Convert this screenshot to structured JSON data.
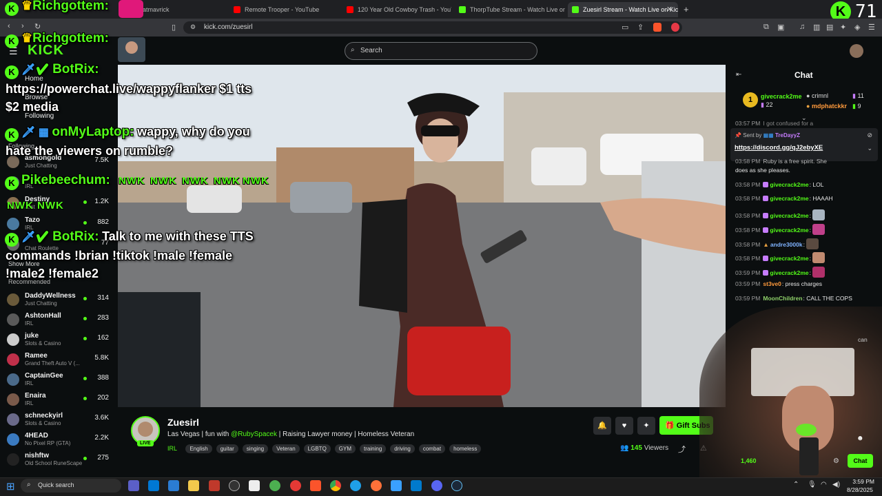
{
  "browser": {
    "tabs": [
      {
        "label": "atmavrick"
      },
      {
        "label": "Remote Trooper - YouTube"
      },
      {
        "label": "120 Year Old Cowboy Trash - YouTube"
      },
      {
        "label": "ThorpTube Stream - Watch Live on Kick"
      },
      {
        "label": "Zuesirl Stream - Watch Live on Kick"
      }
    ],
    "url": "kick.com/zuesirl",
    "counter": "71"
  },
  "site": {
    "search_placeholder": "Search",
    "nav": {
      "home": "Home",
      "browse": "Browse",
      "following": "Following"
    },
    "following_header": "Following",
    "show_more": "Show More",
    "recommended_header": "Recommended",
    "following_channels": [
      {
        "name": "asmongold",
        "category": "Just Chatting",
        "viewers": "7.5K"
      },
      {
        "name": "",
        "category": "IRL",
        "viewers": ""
      },
      {
        "name": "Destiny",
        "category": "Just",
        "viewers": "1.2K"
      },
      {
        "name": "Tazo",
        "category": "IRL",
        "viewers": "882"
      },
      {
        "name": "",
        "category": "Chat Roulette",
        "viewers": "77"
      }
    ],
    "recommended_channels": [
      {
        "name": "DaddyWellness",
        "category": "Just Chatting",
        "viewers": "314"
      },
      {
        "name": "AshtonHall",
        "category": "IRL",
        "viewers": "283"
      },
      {
        "name": "juke",
        "category": "Slots & Casino",
        "viewers": "162"
      },
      {
        "name": "Ramee",
        "category": "Grand Theft Auto V (...",
        "viewers": "5.8K"
      },
      {
        "name": "CaptainGee",
        "category": "IRL",
        "viewers": "388"
      },
      {
        "name": "Enaira",
        "category": "IRL",
        "viewers": "202"
      },
      {
        "name": "schneckyirl",
        "category": "Slots & Casino",
        "viewers": "3.6K"
      },
      {
        "name": "4HEAD",
        "category": "No Pixel RP (GTA)",
        "viewers": "2.2K"
      },
      {
        "name": "nishftw",
        "category": "Old School RuneScape",
        "viewers": "275"
      }
    ]
  },
  "overlay": {
    "top_user": "Richgottem:",
    "kick_word": "KICK",
    "alerts": [
      {
        "user": "BotRix:",
        "text": "https://powerchat.live/wappyflanker $1 tts",
        "text2": "$2 media"
      },
      {
        "user": "onMyLaptop:",
        "text": "wappy, why do you",
        "text2": "hate the viewers on rumble?"
      },
      {
        "user": "Pikebeechum:",
        "text": "",
        "text2": ""
      },
      {
        "user": "BotRix:",
        "text": "Talk to me with these TTS",
        "text2": "commands !brian !tiktok !male !female",
        "text3": "!male2 !female2"
      }
    ],
    "emote_word": "NWK"
  },
  "stream": {
    "live_badge": "LIVE",
    "channel": "Zuesirl",
    "title_pre": "Las Vegas | fun with ",
    "title_mention": "@RubySpacek",
    "title_post": " | Raising Lawyer money | Homeless Veteran",
    "category": "IRL",
    "tags": [
      "English",
      "guitar",
      "singing",
      "Veteran",
      "LGBTQ",
      "GYM",
      "training",
      "driving",
      "combat",
      "homeless"
    ],
    "viewers": "145",
    "viewers_label": "Viewers",
    "gift_label": "Gift Subs"
  },
  "chat": {
    "title": "Chat",
    "leaderboard": [
      {
        "rank": "1",
        "user": "givecrack2me",
        "count": "22"
      },
      {
        "rank": "",
        "user": "crimnl",
        "count": "11"
      },
      {
        "rank": "",
        "user": "mdphatckkr",
        "count": "9"
      }
    ],
    "pinned_prefix": "Sent by",
    "pinned_user": "TreDayyZ",
    "pinned_link": "https://discord.gg/qJ2ebyXE",
    "partial_top": "I got confused for a",
    "partial_2": "Ruby is a free spirit. She",
    "partial_3": "does as she pleases.",
    "messages": [
      {
        "time": "03:58 PM",
        "user": "givecrack2me",
        "text": ": LOL",
        "color": "#53fc18"
      },
      {
        "time": "03:58 PM",
        "user": "givecrack2me",
        "text": ": HAAAH",
        "color": "#53fc18"
      },
      {
        "time": "03:58 PM",
        "user": "givecrack2me",
        "text": ":",
        "color": "#53fc18"
      },
      {
        "time": "03:58 PM",
        "user": "givecrack2me",
        "text": ":",
        "color": "#53fc18"
      },
      {
        "time": "03:58 PM",
        "user": "andre3000k",
        "text": ":",
        "color": "#7fb3ff"
      },
      {
        "time": "03:58 PM",
        "user": "givecrack2me",
        "text": ":",
        "color": "#53fc18"
      },
      {
        "time": "03:59 PM",
        "user": "givecrack2me",
        "text": ":",
        "color": "#53fc18"
      },
      {
        "time": "03:59 PM",
        "user": "st3ve0",
        "text": ": press charges",
        "color": "#ff9a3c"
      },
      {
        "time": "03:59 PM",
        "user": "MoonChildren",
        "text": ": CALL THE COPS",
        "color": "#8fd16a"
      }
    ],
    "partial_can": "can",
    "counter_bottom": "1,460",
    "send_label": "Chat"
  },
  "taskbar": {
    "search_label": "Quick search",
    "time": "3:59 PM",
    "date": "8/28/2025"
  }
}
